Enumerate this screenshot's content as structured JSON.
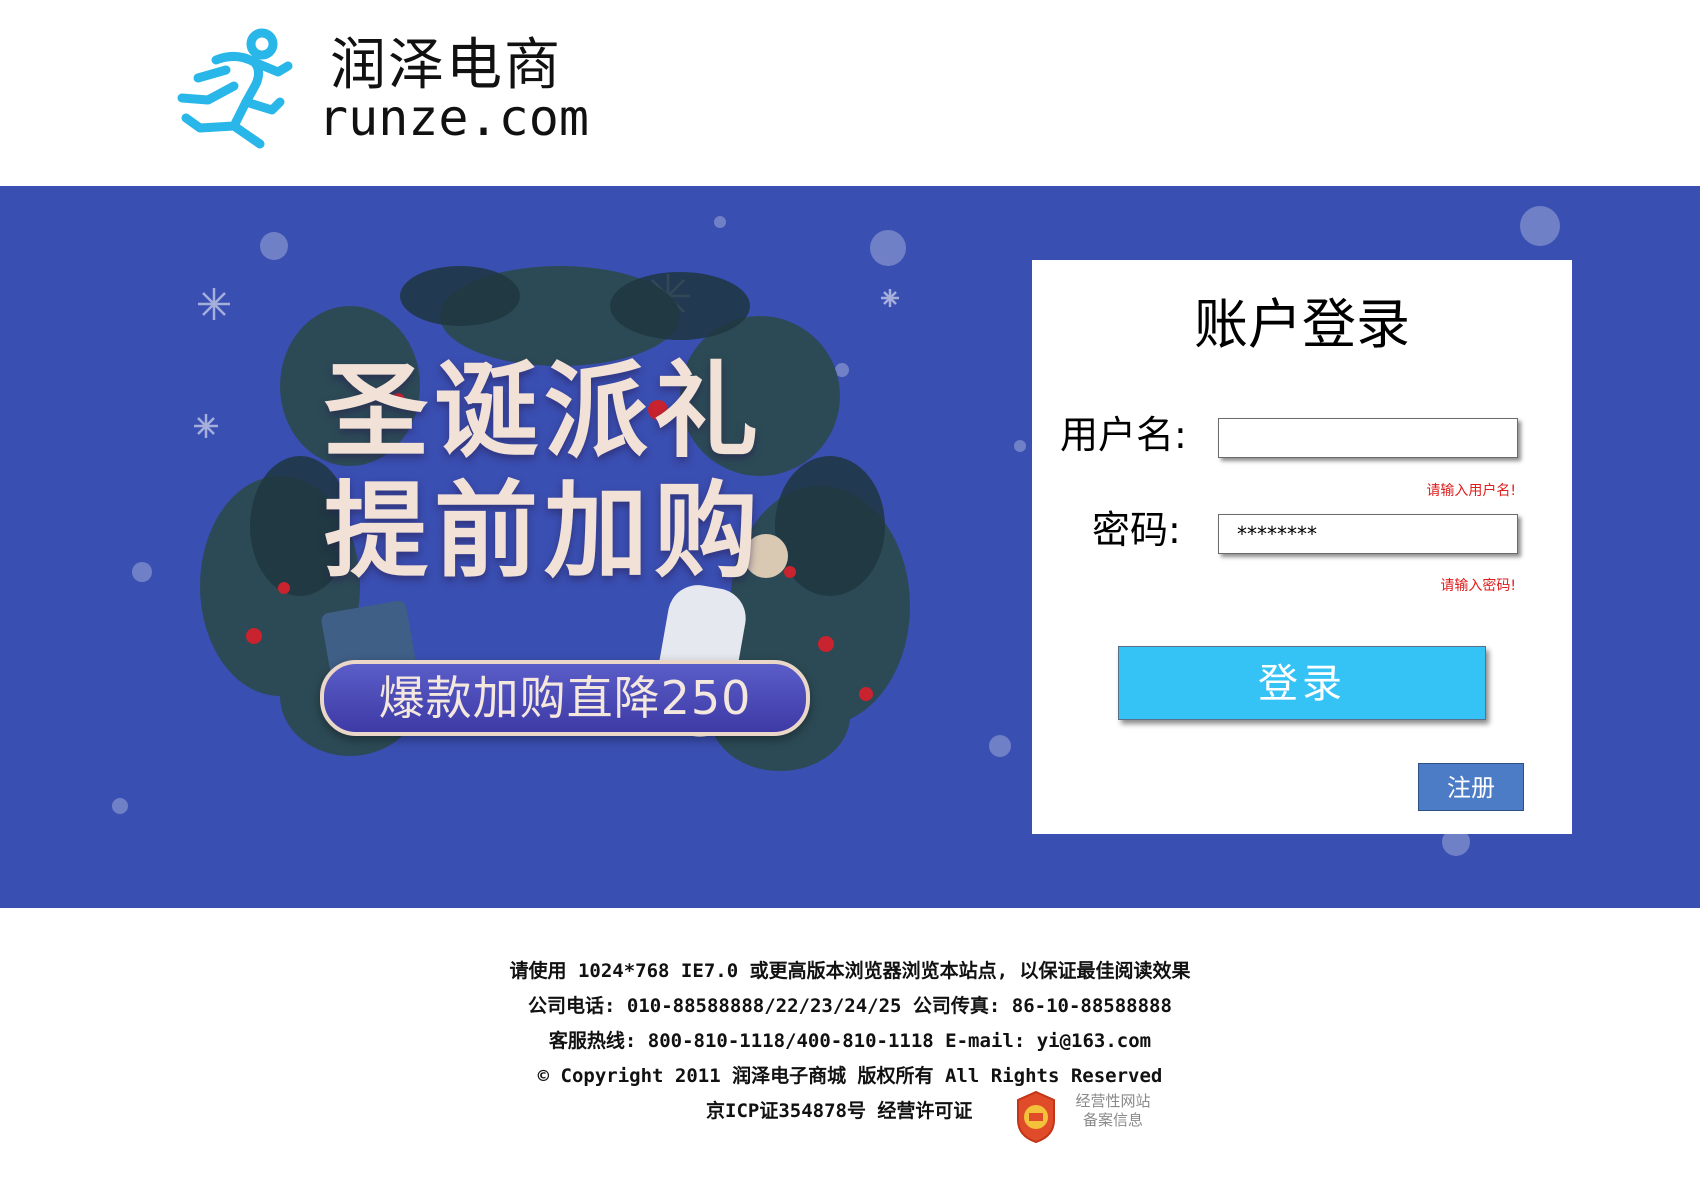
{
  "brand": {
    "name_cn": "润泽电商",
    "domain": "runze.com",
    "logo_icon": "running-man-icon",
    "logo_color": "#29b6e8"
  },
  "banner": {
    "background": "#3a4fb2",
    "promo": {
      "title_line1": "圣诞派礼",
      "title_line2": "提前加购",
      "tagline": "爆款加购直降250"
    }
  },
  "login": {
    "title": "账户登录",
    "username_label": "用户名:",
    "username_value": "",
    "password_label": "密码:",
    "password_value": "********",
    "username_hint": "请输入用户名!",
    "password_hint": "请输入密码!",
    "login_button": "登录",
    "register_button": "注册",
    "accent_color": "#35c3f6",
    "error_color": "#e01d1d"
  },
  "footer": {
    "line1": "请使用 1024*768 IE7.0 或更高版本浏览器浏览本站点, 以保证最佳阅读效果",
    "line2": "公司电话: 010-88588888/22/23/24/25 公司传真: 86-10-88588888",
    "line3": "客服热线: 800-810-1118/400-810-1118  E-mail: yi@163.com",
    "line4": "© Copyright  2011 润泽电子商城 版权所有 All Rights Reserved",
    "line5": "京ICP证354878号 经营许可证",
    "badge_icon": "website-filing-badge-icon",
    "badge_text_line1": "经营性网站",
    "badge_text_line2": "备案信息"
  }
}
